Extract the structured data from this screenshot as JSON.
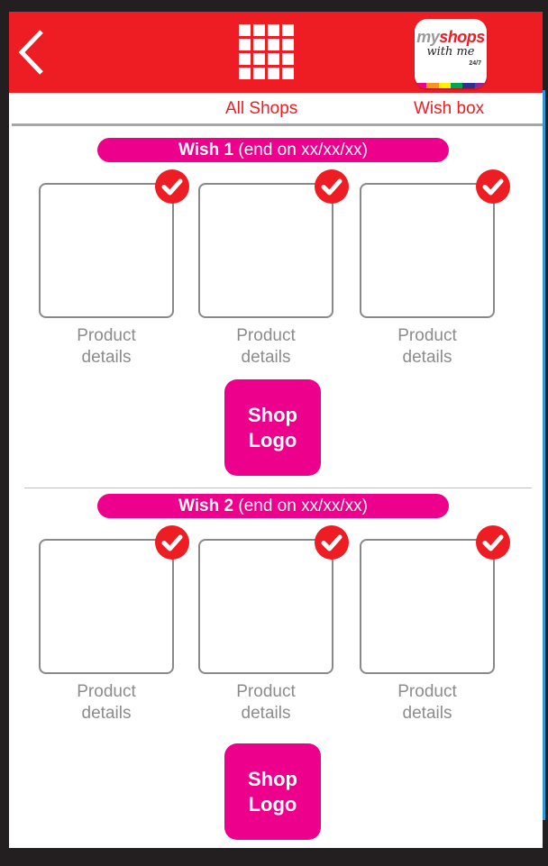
{
  "header": {
    "back_icon": "chevron-left-icon",
    "grid_icon": "grid-icon",
    "logo": {
      "text_my": "my",
      "text_shops": "shops",
      "text_with": "with me",
      "text_247": "24/7"
    }
  },
  "tabs": [
    {
      "label": "All Shops"
    },
    {
      "label": "Wish box"
    }
  ],
  "wishes": [
    {
      "title": "Wish 1",
      "end_text": "(end on xx/xx/xx)",
      "products": [
        {
          "label_line1": "Product",
          "label_line2": "details",
          "checked": true
        },
        {
          "label_line1": "Product",
          "label_line2": "details",
          "checked": true
        },
        {
          "label_line1": "Product",
          "label_line2": "details",
          "checked": true
        }
      ],
      "shop_logo_line1": "Shop",
      "shop_logo_line2": "Logo"
    },
    {
      "title": "Wish 2",
      "end_text": "(end on xx/xx/xx)",
      "products": [
        {
          "label_line1": "Product",
          "label_line2": "details",
          "checked": true
        },
        {
          "label_line1": "Product",
          "label_line2": "details",
          "checked": true
        },
        {
          "label_line1": "Product",
          "label_line2": "details",
          "checked": true
        }
      ],
      "shop_logo_line1": "Shop",
      "shop_logo_line2": "Logo"
    }
  ],
  "colors": {
    "header_red": "#ee1d24",
    "accent_pink": "#ec008c",
    "border_gray": "#898989",
    "label_gray": "#8c8c8c",
    "logo_stripes": [
      "#ec008c",
      "#f7941d",
      "#fff200",
      "#00a651",
      "#2e3192",
      "#92278f"
    ]
  }
}
